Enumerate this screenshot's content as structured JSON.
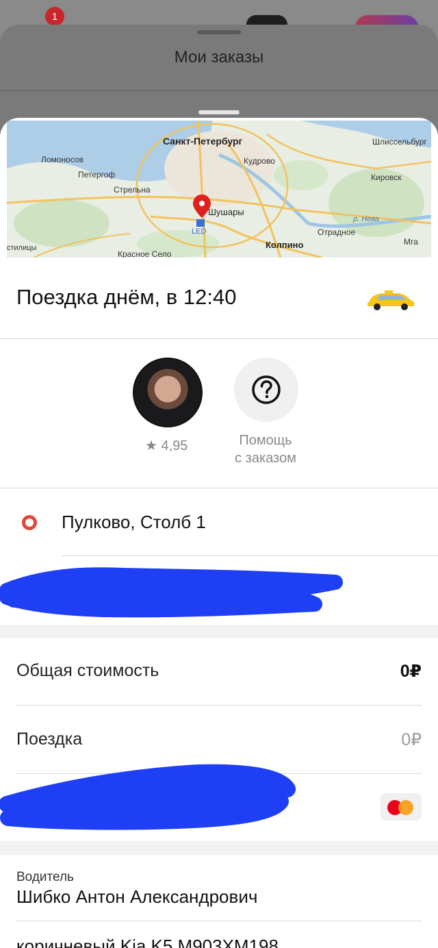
{
  "background_app": {
    "notification_count": "1"
  },
  "orders_sheet": {
    "title": "Мои заказы"
  },
  "map": {
    "labels": {
      "spb": "Санкт-Петербург",
      "shlisselburg": "Шлиссельбург",
      "lomonosov": "Ломоносов",
      "kudrovo": "Кудрово",
      "peterhof": "Петергоф",
      "kirovsk": "Кировск",
      "strelna": "Стрельна",
      "shushary": "Шушары",
      "neva": "р. Нева",
      "otradnoe": "Отрадное",
      "led": "LED",
      "mga": "Мга",
      "kolpino": "Колпино",
      "kipen": "стилицы",
      "krasnoe_selo": "Красное Село"
    },
    "pin_icon": "location-pin-icon"
  },
  "trip": {
    "title": "Поездка днём, в 12:40",
    "icon": "taxi-car-icon"
  },
  "driver_summary": {
    "rating": "★ 4,95",
    "help_icon": "question-circle-icon",
    "help_label_line1": "Помощь",
    "help_label_line2": "с заказом"
  },
  "route": {
    "start_point": "Пулково, Столб 1"
  },
  "cost": {
    "total_label": "Общая стоимость",
    "total_value": "0₽",
    "ride_label": "Поездка",
    "ride_value": "0₽",
    "payment_icon": "mastercard-icon"
  },
  "driver": {
    "caption": "Водитель",
    "name": "Шибко Антон Александрович",
    "car": "коричневый Kia K5 М903ХМ198"
  },
  "colors": {
    "accent_red": "#e2443a",
    "pin_red": "#e0201c",
    "taxi_yellow": "#f5c518",
    "redaction_blue": "#1f3ff5"
  }
}
